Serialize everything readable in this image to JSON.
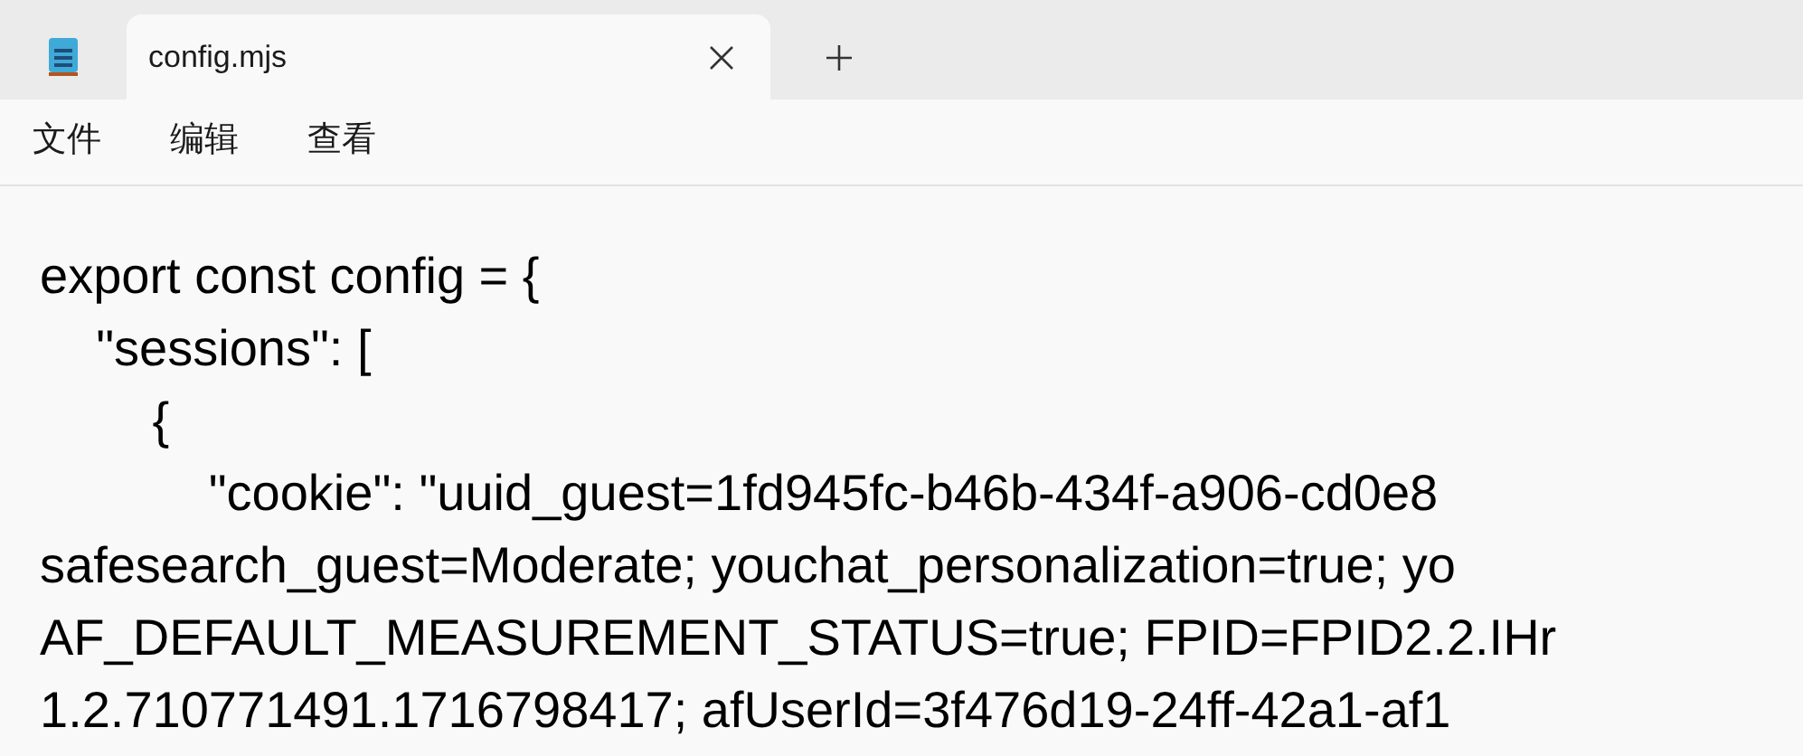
{
  "tabs": [
    {
      "label": "config.mjs",
      "selected": true
    }
  ],
  "menu": [
    "文件",
    "编辑",
    "查看"
  ],
  "lines": [
    "export const config = {",
    "    \"sessions\": [",
    "        {",
    "            \"cookie\": \"uuid_guest=1fd945fc-b46b-434f-a906-cd0e8",
    "safesearch_guest=Moderate; youchat_personalization=true; yo",
    "AF_DEFAULT_MEASUREMENT_STATUS=true; FPID=FPID2.2.IHr",
    "1.2.710771491.1716798417; afUserId=3f476d19-24ff-42a1-af1"
  ]
}
